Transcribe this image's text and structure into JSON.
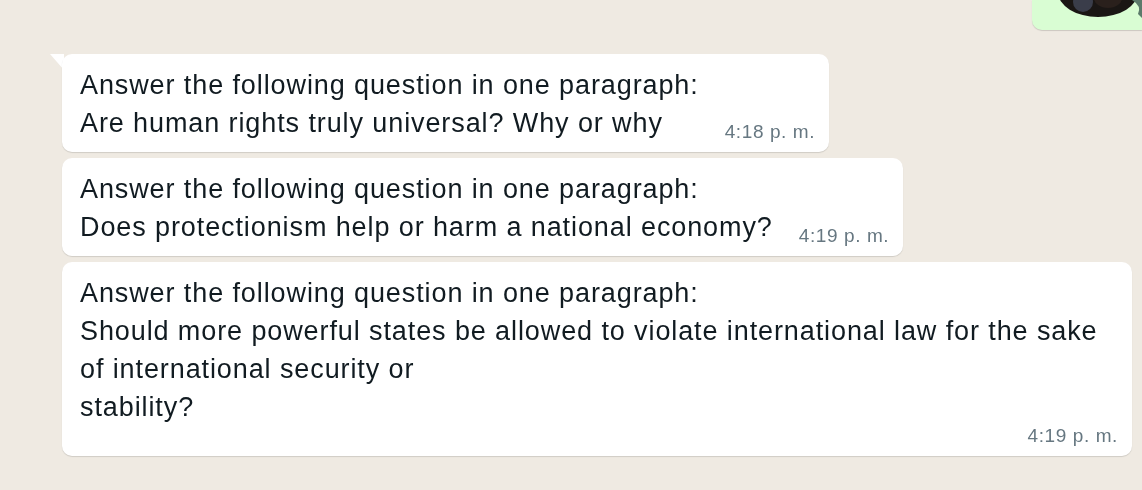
{
  "messages": [
    {
      "tail": true,
      "lines": [
        "Answer the following question in one paragraph:",
        "Are human rights truly universal? Why or why"
      ],
      "time": "4:18 p. m."
    },
    {
      "tail": false,
      "lines": [
        "Answer the following question in one paragraph:",
        "Does protectionism help or harm a national economy?"
      ],
      "time": "4:19 p. m."
    },
    {
      "tail": false,
      "lines": [
        "Answer the following question in one paragraph:",
        "Should more powerful states be allowed to violate international law for the sake",
        "of international security or",
        "stability?"
      ],
      "time": "4:19 p. m."
    }
  ]
}
